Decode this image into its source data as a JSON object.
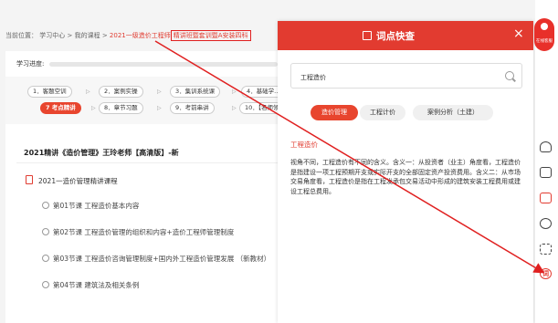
{
  "breadcrumb": {
    "prefix": "当前位置：",
    "items": [
      "学习中心",
      "我的课程"
    ],
    "sep": ">",
    "current": "2021一级造价工程师",
    "current_tail": "精讲班暨套训暨A安装四科"
  },
  "progress": {
    "label": "学习进度:",
    "value": 0
  },
  "steps": [
    {
      "label": "1．客题空训"
    },
    {
      "label": "2．案例实操"
    },
    {
      "label": "3．集训系统课"
    },
    {
      "label": "4．基础学..."
    },
    {
      "label": "考点精讲",
      "num": "7"
    },
    {
      "label": "8．章节习题"
    },
    {
      "label": "9．考前串讲"
    },
    {
      "label": "10．【名师领..."
    }
  ],
  "course": {
    "title": "2021精讲《造价管理》王玲老师【高清版】-新",
    "chapter": "2021一造价管理精讲课程",
    "lessons": [
      "第01节课 工程造价基本内容",
      "第02节课 工程造价管理的组织和内容+造价工程师管理制度",
      "第03节课 工程造价咨询管理制度+国内外工程造价管理发展 （新教材）",
      "第04节课 建筑法及相关条例"
    ]
  },
  "panel": {
    "title": "词点快查",
    "close": "×",
    "search_value": "工程造价",
    "tabs": [
      {
        "label": "造价管理",
        "active": true
      },
      {
        "label": "工程计价",
        "active": false
      },
      {
        "label": "案例分析（土建）",
        "active": false
      }
    ],
    "term": "工程造价",
    "definition": "视角不同，工程造价有不同的含义。含义一：从投资者（业主）角度看，工程造价是指建设一项工程预期开支或实际开支的全部固定资产投资费用。含义二：从市场交易角度看，工程造价是指在工程发承包交易活动中形成的建筑安装工程费用或建设工程总费用。"
  },
  "rail": {
    "badge_label": "在线客服",
    "icons": [
      "headset-icon",
      "card-icon",
      "printer-icon",
      "chat-icon",
      "apps-icon",
      "dictionary-icon"
    ],
    "dict_char": "词"
  },
  "colors": {
    "accent": "#e23b30",
    "annotation": "#e02020"
  }
}
